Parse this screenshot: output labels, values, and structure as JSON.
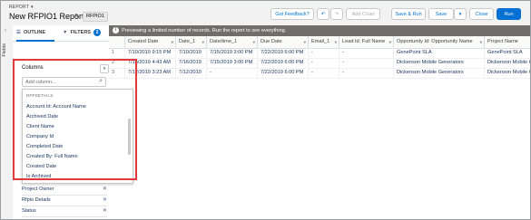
{
  "header": {
    "eyebrow": "REPORT",
    "eyebrow_chevron": "▾",
    "title": "New RFPIO1 Report",
    "pencil_icon": "✎",
    "badge": "RFPIO1",
    "buttons": {
      "feedback": "Got Feedback?",
      "undo": "↶",
      "redo": "↷",
      "add_chart": "Add Chart",
      "save_run": "Save & Run",
      "save": "Save",
      "save_menu": "▾",
      "close": "Close",
      "run": "Run"
    }
  },
  "rail": {
    "caret": "›",
    "label": "Fields"
  },
  "tabs": {
    "outline_icon": "☰",
    "outline": "OUTLINE",
    "filters_icon": "▼",
    "filters": "FILTERS",
    "filters_count": "2"
  },
  "columns_panel": {
    "heading": "Columns",
    "dropdown_icon": "▾",
    "search_placeholder": "Add column...",
    "search_icon": "⌕",
    "group_label": "RFPDETAILS",
    "options": [
      "Account Id: Account Name",
      "Archived Date",
      "Client Name",
      "Company Id",
      "Completed Date",
      "Created By: Full Name",
      "Created Date",
      "Is Archived"
    ],
    "selected_fields": [
      "Project Owner",
      "Rfpio Details",
      "Status"
    ],
    "remove_icon": "✕"
  },
  "notice": {
    "icon": "i",
    "text": "Previewing a limited number of records. Run the report to see everything."
  },
  "grid": {
    "headers": [
      "Created Date",
      "Date_1",
      "Date/time_1",
      "Due Date",
      "Email_1",
      "Lead Id: Full Name",
      "Opportunity Id: Opportunity Name",
      "Project Name"
    ],
    "sort_icon": "▾",
    "rows": [
      {
        "n": "1",
        "cells": [
          "7/10/2019 9:15 PM",
          "7/10/2019",
          "7/15/2019 3:00 PM",
          "7/22/2019 6:00 PM",
          "-",
          "-",
          "GenePoint SLA",
          "GenePoint SLA"
        ]
      },
      {
        "n": "2",
        "cells": [
          "7/15/2019 4:43 AM",
          "7/16/2019",
          "7/15/2019 3:00 PM",
          "7/22/2019 6:00 PM",
          "-",
          "-",
          "Dickenson Mobile Generators",
          "Dickenson Mobile Generators"
        ]
      },
      {
        "n": "3",
        "cells": [
          "7/12/2019 3:23 AM",
          "7/12/2019",
          "-",
          "7/22/2019 6:00 PM",
          "-",
          "-",
          "Dickenson Mobile Generators",
          "Dickenson Mobile Generators"
        ]
      }
    ]
  }
}
